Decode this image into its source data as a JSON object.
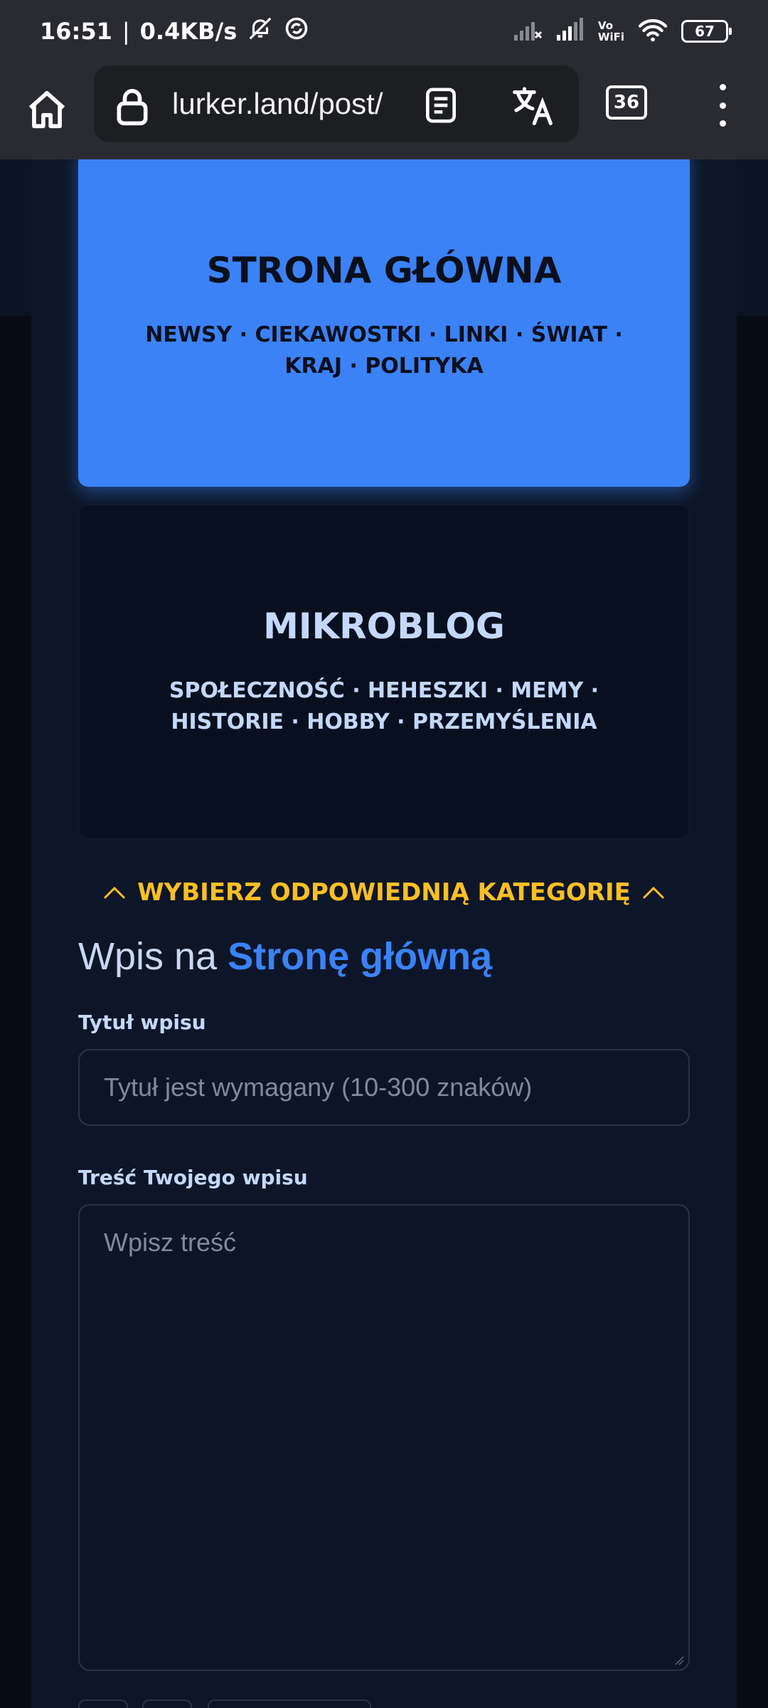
{
  "status_bar": {
    "time": "16:51",
    "net_speed": "0.4KB/s",
    "separator": "|",
    "vowifi_top": "Vo",
    "vowifi_bottom": "WiFi",
    "battery": "67"
  },
  "browser": {
    "url": "lurker.land/post/",
    "tab_count": "36"
  },
  "categories": [
    {
      "title": "STRONA GŁÓWNA",
      "tags": "NEWSY · CIEKAWOSTKI · LINKI · ŚWIAT · KRAJ · POLITYKA",
      "selected": true
    },
    {
      "title": "MIKROBLOG",
      "tags": "SPOŁECZNOŚĆ · HEHESZKI · MEMY · HISTORIE · HOBBY · PRZEMYŚLENIA",
      "selected": false
    }
  ],
  "choose_category": "WYBIERZ ODPOWIEDNIĄ KATEGORIĘ",
  "form": {
    "heading_prefix": "Wpis na",
    "heading_target": "Stronę główną",
    "title_label": "Tytuł wpisu",
    "title_placeholder": "Tytuł jest wymagany (10-300 znaków)",
    "body_label": "Treść Twojego wpisu",
    "body_placeholder": "Wpisz treść"
  },
  "colors": {
    "accent_blue": "#3b82f6",
    "warning_yellow": "#fbbf24",
    "page_background": "#0d1628",
    "toolbar": "#2a2b31"
  }
}
